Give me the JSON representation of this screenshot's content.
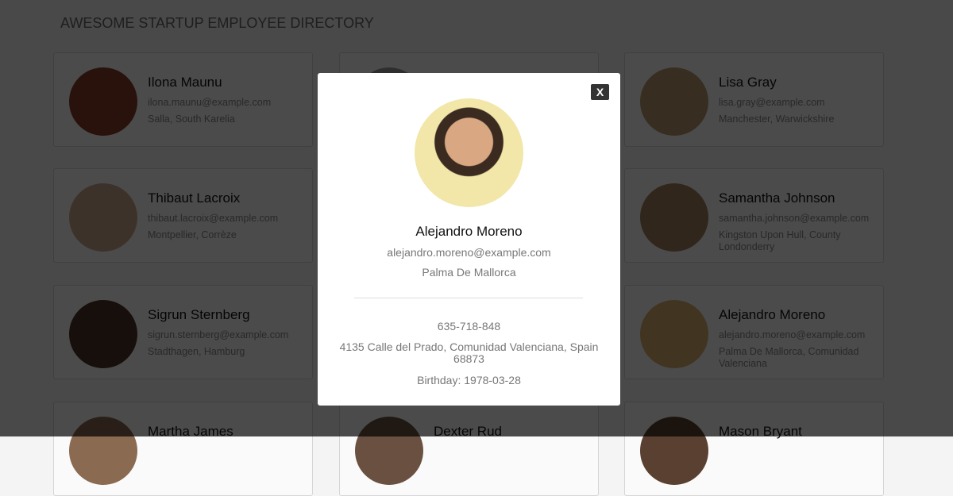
{
  "header": {
    "title": "AWESOME STARTUP EMPLOYEE DIRECTORY"
  },
  "employees": [
    {
      "name": "Ilona Maunu",
      "email": "ilona.maunu@example.com",
      "location": "Salla, South Karelia",
      "avatar_color": "#8a3b2a"
    },
    {
      "name": "",
      "email": "",
      "location": "",
      "avatar_color": "#999999"
    },
    {
      "name": "Lisa Gray",
      "email": "lisa.gray@example.com",
      "location": "Manchester, Warwickshire",
      "avatar_color": "#b89a70"
    },
    {
      "name": "Thibaut Lacroix",
      "email": "thibaut.lacroix@example.com",
      "location": "Montpellier, Corrèze",
      "avatar_color": "#c9a88e"
    },
    {
      "name": "",
      "email": "",
      "location": "",
      "avatar_color": "#999999"
    },
    {
      "name": "Samantha Johnson",
      "email": "samantha.johnson@example.com",
      "location": "Kingston Upon Hull, County Londonderry",
      "avatar_color": "#a08060"
    },
    {
      "name": "Sigrun Sternberg",
      "email": "sigrun.sternberg@example.com",
      "location": "Stadthagen, Hamburg",
      "avatar_color": "#4a3328"
    },
    {
      "name": "",
      "email": "",
      "location": "",
      "avatar_color": "#999999"
    },
    {
      "name": "Alejandro Moreno",
      "email": "alejandro.moreno@example.com",
      "location": "Palma De Mallorca, Comunidad Valenciana",
      "avatar_color": "#d9b070"
    },
    {
      "name": "Martha James",
      "email": "",
      "location": "",
      "avatar_color": "#8a6a50"
    },
    {
      "name": "Dexter Rud",
      "email": "",
      "location": "",
      "avatar_color": "#6a5040"
    },
    {
      "name": "Mason Bryant",
      "email": "",
      "location": "",
      "avatar_color": "#5a4030"
    }
  ],
  "modal": {
    "close_label": "X",
    "name": "Alejandro Moreno",
    "email": "alejandro.moreno@example.com",
    "city": "Palma De Mallorca",
    "phone": "635-718-848",
    "address_line1": "4135 Calle del Prado, Comunidad Valenciana, Spain",
    "address_line2": "68873",
    "birthday": "Birthday: 1978-03-28"
  }
}
